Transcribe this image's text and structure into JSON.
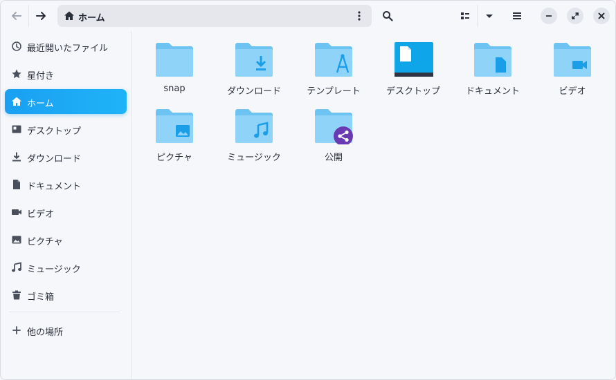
{
  "header": {
    "path_label": "ホーム",
    "icons": {
      "back": "arrow-left-icon",
      "forward": "arrow-right-icon",
      "home": "home-icon",
      "menu": "kebab-menu-icon",
      "search": "search-icon",
      "view": "list-view-icon",
      "view_options": "chevron-down-icon",
      "main_menu": "hamburger-menu-icon",
      "minimize": "minimize-icon",
      "maximize": "maximize-icon",
      "close": "close-icon"
    }
  },
  "sidebar": {
    "items": [
      {
        "label": "最近開いたファイル",
        "icon": "clock-icon"
      },
      {
        "label": "星付き",
        "icon": "star-icon"
      },
      {
        "label": "ホーム",
        "icon": "home-icon",
        "active": true
      },
      {
        "label": "デスクトップ",
        "icon": "desktop-icon"
      },
      {
        "label": "ダウンロード",
        "icon": "download-icon"
      },
      {
        "label": "ドキュメント",
        "icon": "document-icon"
      },
      {
        "label": "ビデオ",
        "icon": "video-icon"
      },
      {
        "label": "ピクチャ",
        "icon": "picture-icon"
      },
      {
        "label": "ミュージック",
        "icon": "music-icon"
      },
      {
        "label": "ゴミ箱",
        "icon": "trash-icon"
      }
    ],
    "other_places": {
      "label": "他の場所",
      "icon": "plus-icon"
    }
  },
  "files": [
    {
      "name": "snap",
      "icon": "folder-icon"
    },
    {
      "name": "ダウンロード",
      "icon": "folder-download-icon"
    },
    {
      "name": "テンプレート",
      "icon": "folder-templates-icon"
    },
    {
      "name": "デスクトップ",
      "icon": "desktop-folder-icon"
    },
    {
      "name": "ドキュメント",
      "icon": "folder-documents-icon"
    },
    {
      "name": "ビデオ",
      "icon": "folder-videos-icon"
    },
    {
      "name": "ピクチャ",
      "icon": "folder-pictures-icon"
    },
    {
      "name": "ミュージック",
      "icon": "folder-music-icon"
    },
    {
      "name": "公開",
      "icon": "folder-publicshare-icon"
    }
  ],
  "colors": {
    "accent": "#1aa0f2",
    "folder_body": "#8fd3f8",
    "folder_tab": "#6dc3f2",
    "folder_glyph": "#1a9ee8",
    "share_badge": "#6a3ab2",
    "desktop_icon": "#0ea5e9"
  }
}
